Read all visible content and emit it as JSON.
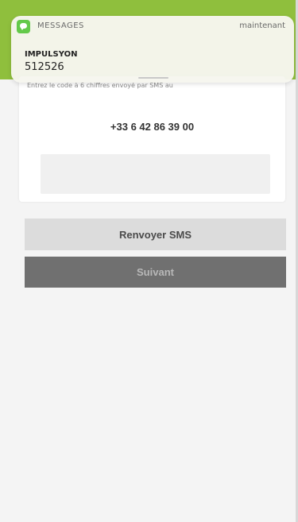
{
  "notification": {
    "app_name": "MESSAGES",
    "time": "maintenant",
    "sender": "IMPULSYON",
    "message": "512526",
    "icon": "messages-icon"
  },
  "verification": {
    "instruction": "Entrez le code à 6 chiffres envoyé par SMS au",
    "phone_number": "+33 6 42 86 39 00",
    "code_value": ""
  },
  "buttons": {
    "resend_label": "Renvoyer SMS",
    "next_label": "Suivant"
  },
  "colors": {
    "header_green": "#8fbf3d",
    "resend_bg": "#dcdcdc",
    "next_bg": "#707070"
  }
}
